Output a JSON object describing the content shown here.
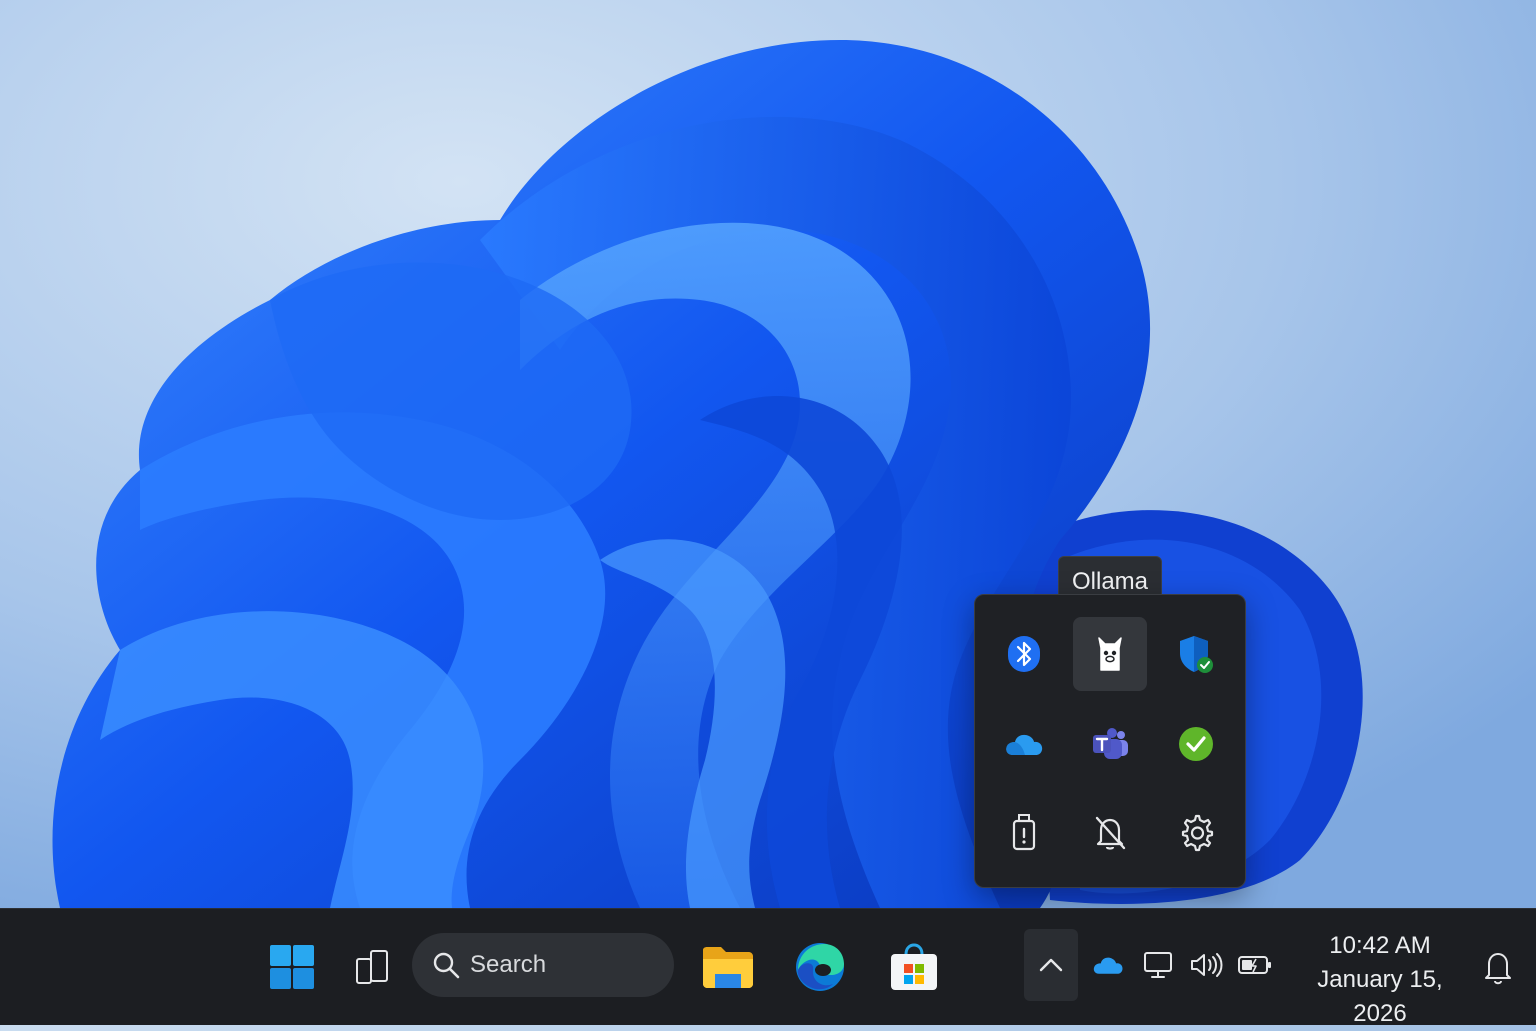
{
  "taskbar": {
    "search": {
      "label": "Search",
      "icon": "search-icon"
    },
    "pinned": [
      {
        "name": "Start",
        "icon": "windows-logo-icon"
      },
      {
        "name": "Task View",
        "icon": "task-view-icon"
      },
      {
        "name": "File Explorer",
        "icon": "folder-icon"
      },
      {
        "name": "Microsoft Edge",
        "icon": "edge-icon"
      },
      {
        "name": "Microsoft Store",
        "icon": "store-bag-icon"
      }
    ],
    "tray": {
      "overflow_icon": "chevron-up-icon",
      "icons": [
        "onedrive-cloud-icon",
        "display-icon",
        "volume-icon",
        "battery-icon"
      ]
    },
    "clock": {
      "time": "10:42 AM",
      "date": "January 15, 2026"
    },
    "notifications_icon": "bell-icon"
  },
  "tray_flyout": {
    "tooltip": "Ollama",
    "hovered": "Ollama",
    "icons": [
      {
        "name": "bluetooth-icon"
      },
      {
        "name": "ollama-icon"
      },
      {
        "name": "security-shield-icon"
      },
      {
        "name": "onedrive-cloud-icon"
      },
      {
        "name": "teams-icon"
      },
      {
        "name": "status-check-icon"
      },
      {
        "name": "usb-eject-icon"
      },
      {
        "name": "notifications-off-icon"
      },
      {
        "name": "settings-gear-icon"
      }
    ]
  },
  "colors": {
    "taskbar_bg": "#1c1e22",
    "flyout_bg": "#1f2125",
    "accent_blue": "#1f6ff2",
    "check_green": "#5fb62a"
  }
}
